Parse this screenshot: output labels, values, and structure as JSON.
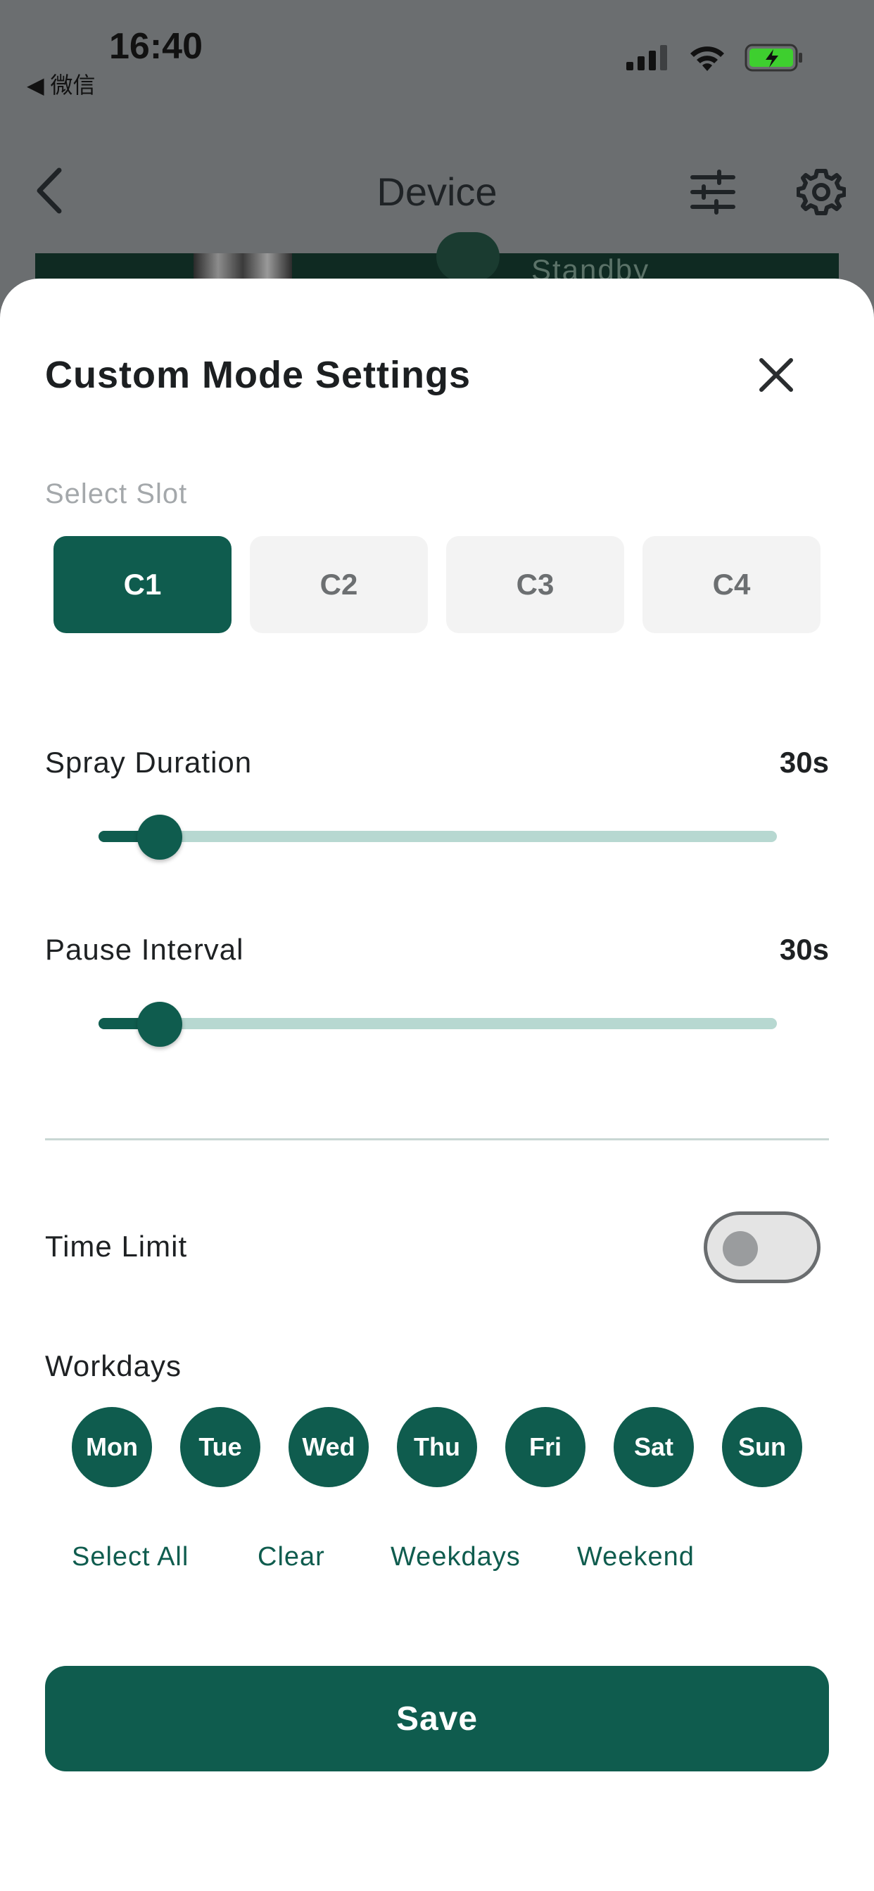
{
  "status_bar": {
    "time": "16:40",
    "back_app": "◀ 微信",
    "battery_color": "#3ecf2f"
  },
  "nav": {
    "title": "Device",
    "back_icon": "chevron-left-icon",
    "filter_icon": "sliders-icon",
    "settings_icon": "gear-icon"
  },
  "device": {
    "status": "Standby"
  },
  "sheet": {
    "title": "Custom Mode Settings",
    "close_icon": "close-icon",
    "slot_label": "Select Slot",
    "slots": [
      {
        "label": "C1",
        "selected": true
      },
      {
        "label": "C2",
        "selected": false
      },
      {
        "label": "C3",
        "selected": false
      },
      {
        "label": "C4",
        "selected": false
      }
    ],
    "spray_duration": {
      "label": "Spray Duration",
      "value": "30s",
      "slider_fraction": 0.09
    },
    "pause_interval": {
      "label": "Pause Interval",
      "value": "30s",
      "slider_fraction": 0.09
    },
    "time_limit": {
      "label": "Time Limit",
      "enabled": false
    },
    "workdays": {
      "label": "Workdays",
      "days": [
        "Mon",
        "Tue",
        "Wed",
        "Thu",
        "Fri",
        "Sat",
        "Sun"
      ],
      "quick": {
        "select_all": "Select All",
        "clear": "Clear",
        "weekdays": "Weekdays",
        "weekend": "Weekend"
      }
    },
    "save_label": "Save"
  },
  "colors": {
    "accent": "#0f5c4e",
    "track": "#b7d8d1",
    "overlay": "#6b6e70"
  }
}
